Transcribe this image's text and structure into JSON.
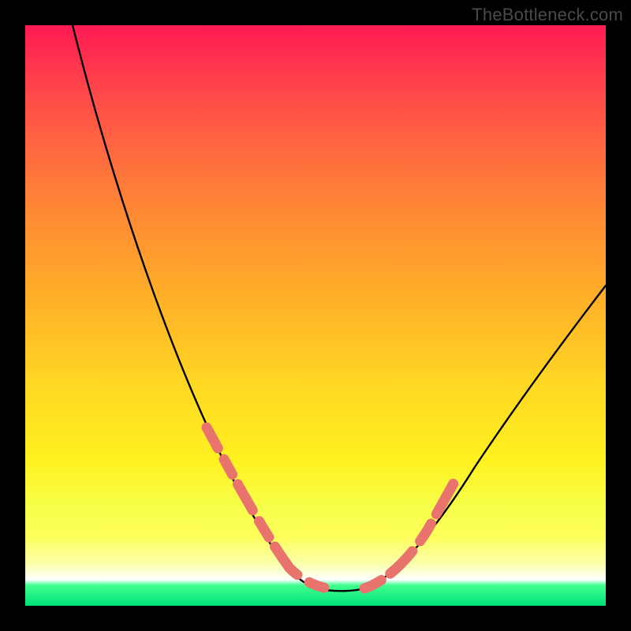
{
  "watermark": "TheBottleneck.com",
  "chart_data": {
    "type": "line",
    "title": "",
    "xlabel": "",
    "ylabel": "",
    "xlim": [
      0,
      100
    ],
    "ylim": [
      0,
      100
    ],
    "series": [
      {
        "name": "bottleneck-curve",
        "x": [
          8,
          12,
          16,
          20,
          24,
          28,
          32,
          36,
          40,
          44,
          47,
          50,
          53,
          56,
          60,
          63,
          67,
          71,
          76,
          82,
          88,
          94,
          100
        ],
        "y": [
          100,
          90,
          79,
          68,
          57,
          47,
          38,
          29,
          21,
          14,
          8,
          4,
          2,
          2,
          3,
          6,
          11,
          18,
          26,
          34,
          42,
          49,
          55
        ]
      }
    ],
    "highlight_segments": [
      {
        "name": "left-dashes",
        "x_range": [
          31,
          47
        ]
      },
      {
        "name": "right-dashes",
        "x_range": [
          58,
          72
        ]
      }
    ],
    "colors": {
      "curve": "#000000",
      "dash": "#e9746e",
      "gradient_top": "#ff1a53",
      "gradient_bottom": "#00e07a"
    }
  }
}
